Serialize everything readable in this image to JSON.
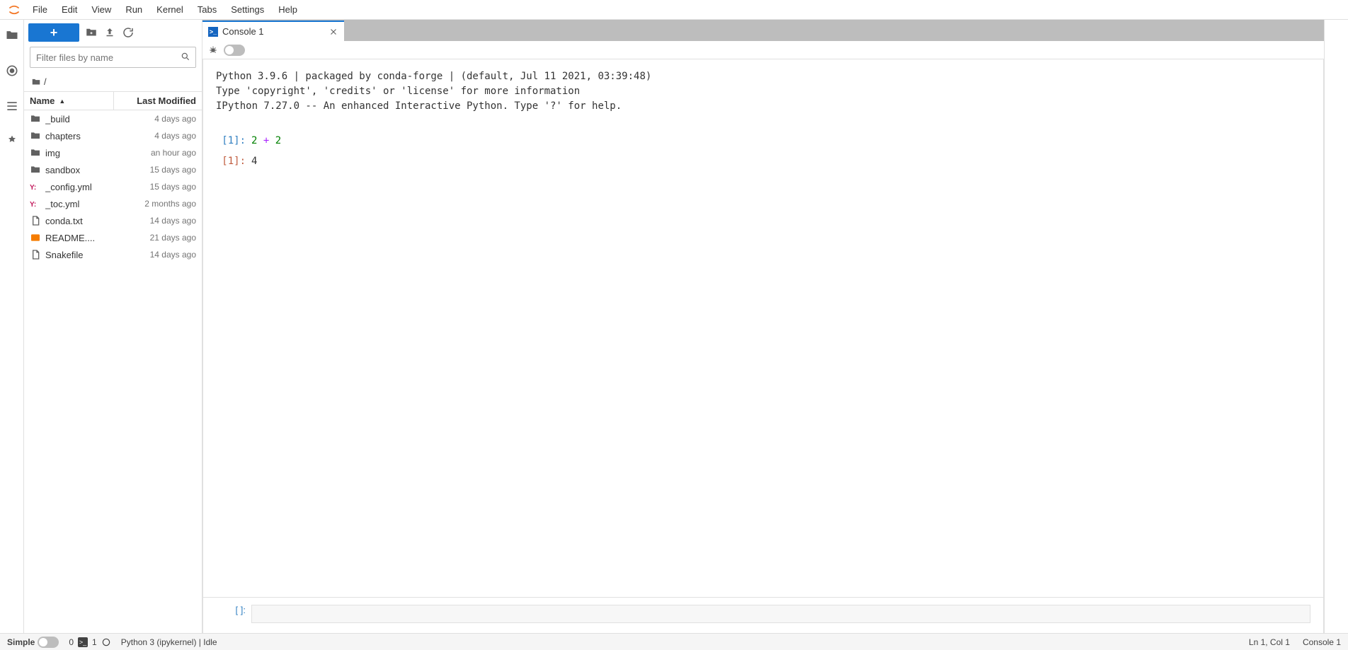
{
  "menu": {
    "items": [
      "File",
      "Edit",
      "View",
      "Run",
      "Kernel",
      "Tabs",
      "Settings",
      "Help"
    ]
  },
  "filebrowser": {
    "filter_placeholder": "Filter files by name",
    "breadcrumb": "/",
    "header": {
      "name": "Name",
      "modified": "Last Modified"
    },
    "items": [
      {
        "icon": "folder",
        "name": "_build",
        "modified": "4 days ago"
      },
      {
        "icon": "folder",
        "name": "chapters",
        "modified": "4 days ago"
      },
      {
        "icon": "folder",
        "name": "img",
        "modified": "an hour ago"
      },
      {
        "icon": "folder",
        "name": "sandbox",
        "modified": "15 days ago"
      },
      {
        "icon": "yaml",
        "name": "_config.yml",
        "modified": "15 days ago"
      },
      {
        "icon": "yaml",
        "name": "_toc.yml",
        "modified": "2 months ago"
      },
      {
        "icon": "file",
        "name": "conda.txt",
        "modified": "14 days ago"
      },
      {
        "icon": "md",
        "name": "README....",
        "modified": "21 days ago"
      },
      {
        "icon": "file",
        "name": "Snakefile",
        "modified": "14 days ago"
      }
    ]
  },
  "tab": {
    "label": "Console 1"
  },
  "console": {
    "banner": "Python 3.9.6 | packaged by conda-forge | (default, Jul 11 2021, 03:39:48) \nType 'copyright', 'credits' or 'license' for more information\nIPython 7.27.0 -- An enhanced Interactive Python. Type '?' for help.",
    "in_prompt": "[1]:",
    "in_code_n1": "2",
    "in_code_op": "+",
    "in_code_n2": "2",
    "out_prompt": "[1]:",
    "out_value": "4",
    "input_prompt": "[ ]:"
  },
  "statusbar": {
    "simple": "Simple",
    "zero": "0",
    "one": "1",
    "kernel": "Python 3 (ipykernel) | Idle",
    "lncol": "Ln 1, Col 1",
    "mode": "Console 1"
  }
}
